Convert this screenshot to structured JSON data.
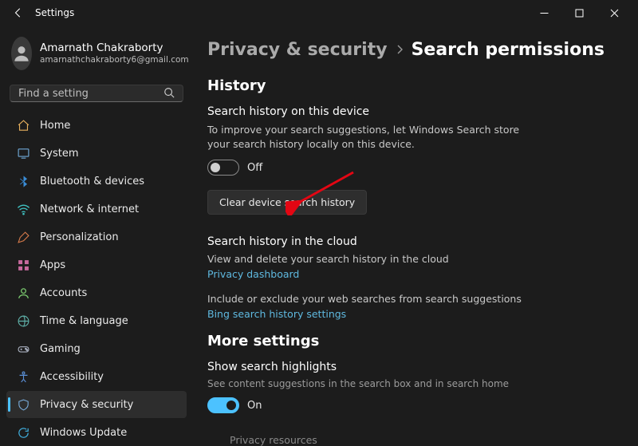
{
  "titlebar": {
    "title": "Settings"
  },
  "profile": {
    "name": "Amarnath Chakraborty",
    "email": "amarnathchakraborty6@gmail.com"
  },
  "search": {
    "placeholder": "Find a setting"
  },
  "nav": {
    "items": [
      {
        "label": "Home"
      },
      {
        "label": "System"
      },
      {
        "label": "Bluetooth & devices"
      },
      {
        "label": "Network & internet"
      },
      {
        "label": "Personalization"
      },
      {
        "label": "Apps"
      },
      {
        "label": "Accounts"
      },
      {
        "label": "Time & language"
      },
      {
        "label": "Gaming"
      },
      {
        "label": "Accessibility"
      },
      {
        "label": "Privacy & security"
      },
      {
        "label": "Windows Update"
      }
    ]
  },
  "breadcrumb": {
    "parent": "Privacy & security",
    "current": "Search permissions"
  },
  "history": {
    "title": "History",
    "device": {
      "heading": "Search history on this device",
      "desc": "To improve your search suggestions, let Windows Search store your search history locally on this device.",
      "toggle_label": "Off",
      "button": "Clear device search history"
    },
    "cloud": {
      "heading": "Search history in the cloud",
      "desc1": "View and delete your search history in the cloud",
      "link1": "Privacy dashboard",
      "desc2": "Include or exclude your web searches from search suggestions",
      "link2": "Bing search history settings"
    }
  },
  "more": {
    "title": "More settings",
    "highlights": {
      "heading": "Show search highlights",
      "desc": "See content suggestions in the search box and in search home",
      "toggle_label": "On"
    },
    "footer": "Privacy resources"
  }
}
